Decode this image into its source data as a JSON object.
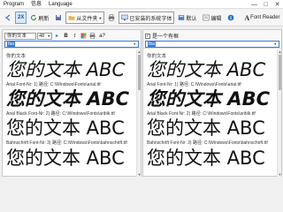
{
  "menu": {
    "program": "Program",
    "info": "信息",
    "language": "Language"
  },
  "window": {
    "minimize_glyph": "—",
    "maximize_glyph": "□",
    "close_glyph": "✕"
  },
  "toolbar": {
    "zoom_label": "2X",
    "refresh_label": "刷新",
    "from_folder_label": "从文件夹",
    "installed_fonts_label": "已安装的系统字体",
    "install_label": "默认",
    "edit_label": "编辑",
    "font_reader_label": "Font Reader",
    "font_reader_letter": "A"
  },
  "left_pane": {
    "sample_text": "你的文本",
    "size_value": "48",
    "bold_label": "B",
    "italic_label": "I",
    "extra_label": "a?",
    "filter_value": "Iba"
  },
  "right_pane": {
    "checkbox_label": "是一个有框",
    "checked": true,
    "filter_value": "Iba"
  },
  "samples": {
    "heading": "你的文本",
    "preview_text": "您的文本 ABC",
    "items": [
      {
        "path": "Arial Font-Nr: 1) 路径: C:\\Windows\\Fonts\\arial.ttf",
        "style": "italic"
      },
      {
        "path": "Arial Black Font-Nr: 2) 路径: C:\\Windows\\Fonts\\ariblk.ttf",
        "style": "blackitalic"
      },
      {
        "path": "Bahnschrift Font-Nr: 3) 路径: C:\\Windows\\Fonts\\bahnschrift.ttf",
        "style": "normal"
      }
    ]
  },
  "colors": {
    "accent": "#3d7bd0",
    "active_button_bg": "#dbe9f8",
    "pane_bg": "#ffffff",
    "window_bg": "#f0f0f0"
  }
}
